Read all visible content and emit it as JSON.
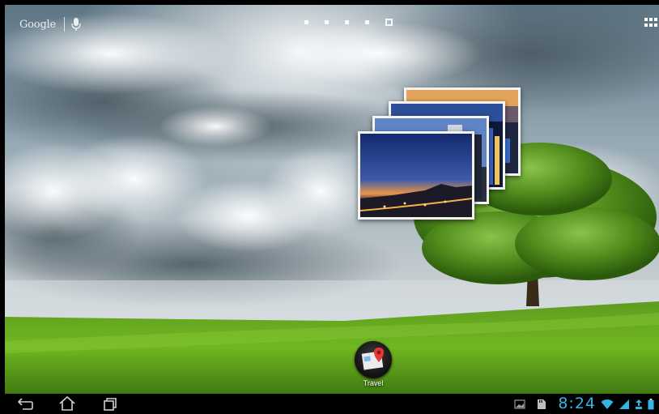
{
  "top_bar": {
    "search_label": "Google",
    "home_pages": [
      {
        "current": false
      },
      {
        "current": false
      },
      {
        "current": false
      },
      {
        "current": false
      },
      {
        "current": true
      }
    ]
  },
  "photo_widget": {
    "photos": [
      "night-city-photo",
      "city-lights-photo",
      "tower-photo",
      "sunset-photo"
    ]
  },
  "desktop": {
    "shortcut": {
      "label": "Travel",
      "icon": "maps-pin-icon"
    }
  },
  "navbar": {
    "buttons": [
      "back-icon",
      "home-icon",
      "recent-apps-icon"
    ],
    "status": {
      "time": "8:24",
      "clock_color": "#33b5e5",
      "icons": [
        "gallery-notification-icon",
        "sd-card-icon",
        "wifi-icon",
        "signal-icon",
        "sync-icon",
        "battery-icon"
      ]
    }
  }
}
